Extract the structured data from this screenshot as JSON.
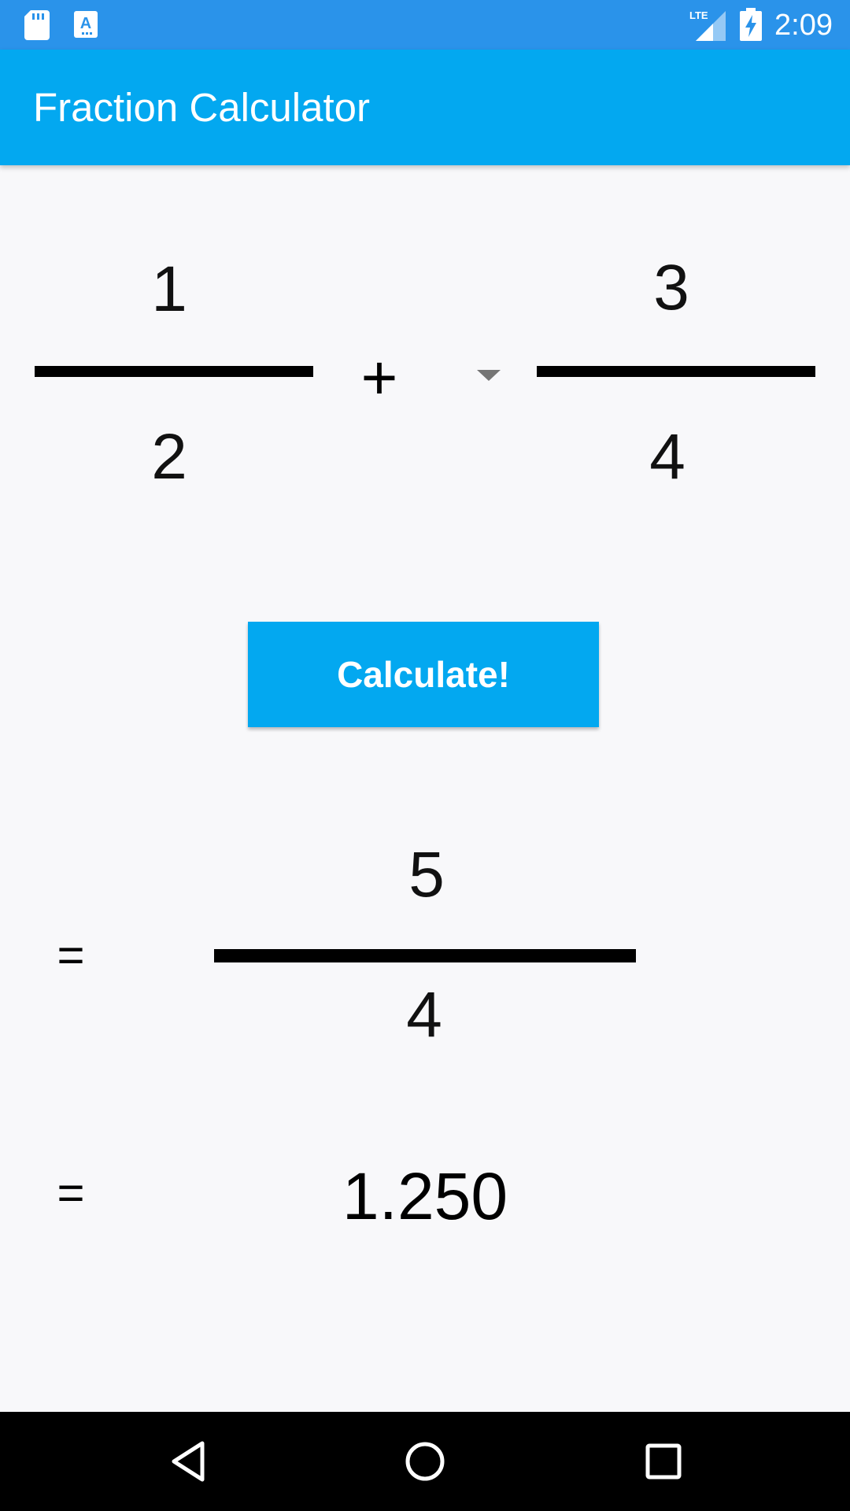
{
  "status_bar": {
    "time": "2:09",
    "network": "LTE",
    "icons": [
      "sd-card-icon",
      "a-notification-icon",
      "lte-signal-icon",
      "battery-charging-icon"
    ]
  },
  "app_bar": {
    "title": "Fraction Calculator",
    "color": "#03a8f0"
  },
  "calculator": {
    "fraction1": {
      "numerator": "1",
      "denominator": "2"
    },
    "operator": "+",
    "fraction2": {
      "numerator": "3",
      "denominator": "4"
    },
    "button_label": "Calculate!",
    "result_equals": "=",
    "result_fraction": {
      "numerator": "5",
      "denominator": "4"
    },
    "decimal_equals": "=",
    "result_decimal": "1.250"
  },
  "nav_bar": {
    "buttons": [
      "back-icon",
      "home-icon",
      "recents-icon"
    ]
  }
}
